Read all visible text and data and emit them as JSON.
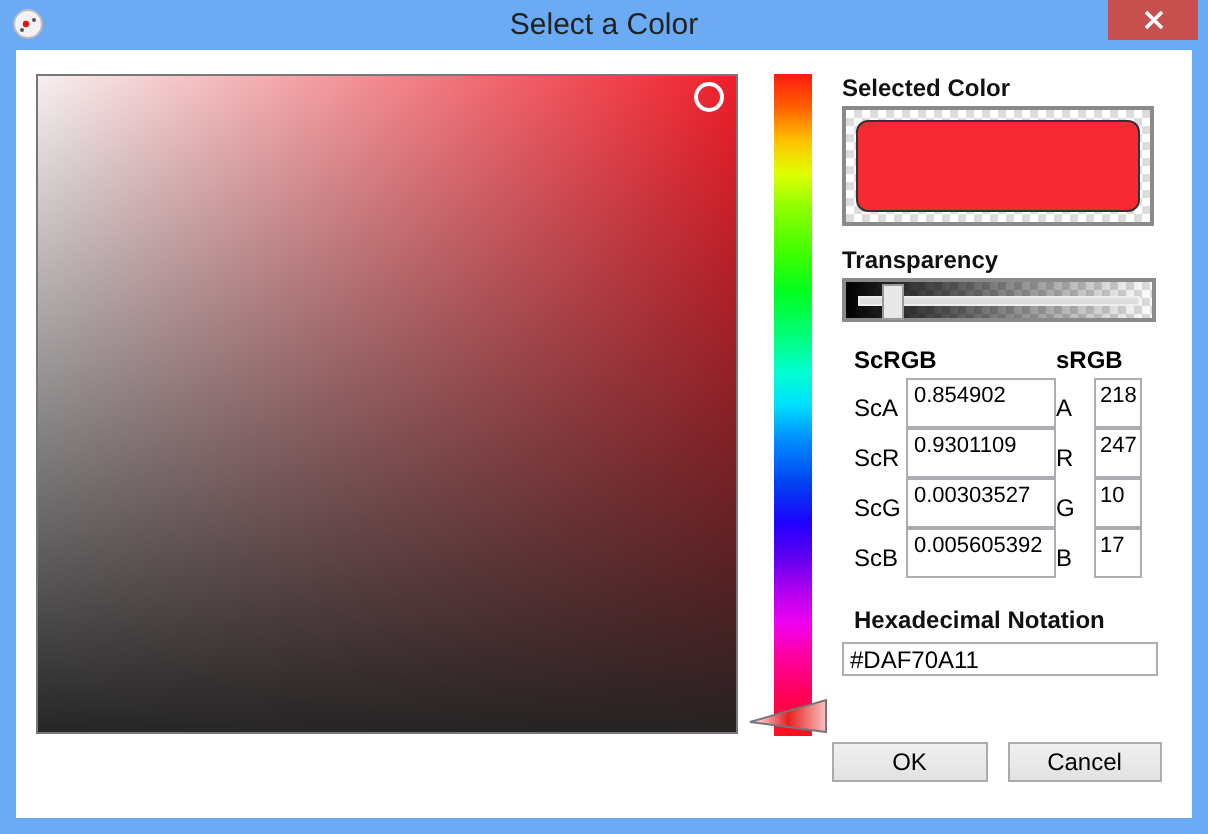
{
  "window": {
    "title": "Select a Color"
  },
  "hue_slider": {
    "level": 0.03
  },
  "selected_color": {
    "label": "Selected Color",
    "color": "#f72a33"
  },
  "transparency": {
    "label": "Transparency",
    "level": 0.15
  },
  "scrgb": {
    "heading": "ScRGB",
    "fields": [
      {
        "label": "ScA",
        "value": "0.854902"
      },
      {
        "label": "ScR",
        "value": "0.9301109"
      },
      {
        "label": "ScG",
        "value": "0.00303527"
      },
      {
        "label": "ScB",
        "value": "0.005605392"
      }
    ]
  },
  "srgb": {
    "heading": "sRGB",
    "fields": [
      {
        "label": "A",
        "value": "218"
      },
      {
        "label": "R",
        "value": "247"
      },
      {
        "label": "G",
        "value": "10"
      },
      {
        "label": "B",
        "value": "17"
      }
    ]
  },
  "hex": {
    "label": "Hexadecimal Notation",
    "value": "#DAF70A11"
  },
  "buttons": [
    {
      "label": "OK"
    },
    {
      "label": "Cancel"
    }
  ]
}
